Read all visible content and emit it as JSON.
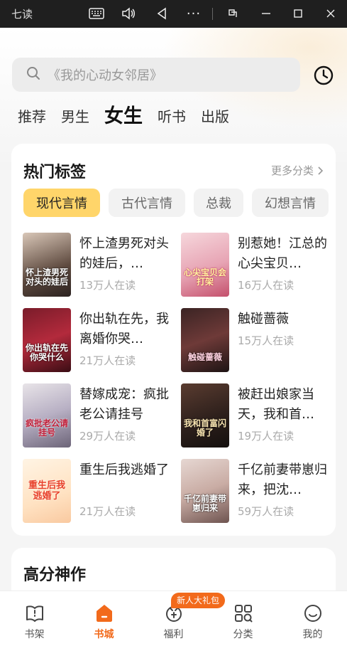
{
  "window": {
    "app_title": "七读"
  },
  "search": {
    "placeholder": "《我的心动女邻居》"
  },
  "channels": [
    "推荐",
    "男生",
    "女生",
    "听书",
    "出版"
  ],
  "hot_tags": {
    "title": "热门标签",
    "more": "更多分类",
    "tags": [
      "现代言情",
      "古代言情",
      "总裁",
      "幻想言情"
    ],
    "books": [
      {
        "title": "怀上渣男死对头的娃后，…",
        "readers": "13万人在读",
        "cover_text": "怀上渣男死对头的娃后"
      },
      {
        "title": "别惹她！江总的心尖宝贝…",
        "readers": "16万人在读",
        "cover_text": "心尖宝贝会打架"
      },
      {
        "title": "你出轨在先，我离婚你哭…",
        "readers": "21万人在读",
        "cover_text": "你出轨在先你哭什么"
      },
      {
        "title": "触碰蔷薇",
        "readers": "15万人在读",
        "cover_text": "触碰蔷薇"
      },
      {
        "title": "替嫁成宠：疯批老公请挂号",
        "readers": "29万人在读",
        "cover_text": "疯批老公请挂号"
      },
      {
        "title": "被赶出娘家当天，我和首…",
        "readers": "19万人在读",
        "cover_text": "我和首富闪婚了"
      },
      {
        "title": "重生后我逃婚了",
        "readers": "21万人在读",
        "cover_text": "重生后我逃婚了"
      },
      {
        "title": "千亿前妻带崽归来，把沈…",
        "readers": "59万人在读",
        "cover_text": "千亿前妻带崽归来"
      }
    ]
  },
  "high_score": {
    "title": "高分神作"
  },
  "bottom_nav": {
    "items": [
      "书架",
      "书城",
      "福利",
      "分类",
      "我的"
    ],
    "badge": "新人大礼包",
    "active": "书城"
  },
  "colors": {
    "accent": "#f26a1b",
    "tag_active": "#ffd56a"
  }
}
